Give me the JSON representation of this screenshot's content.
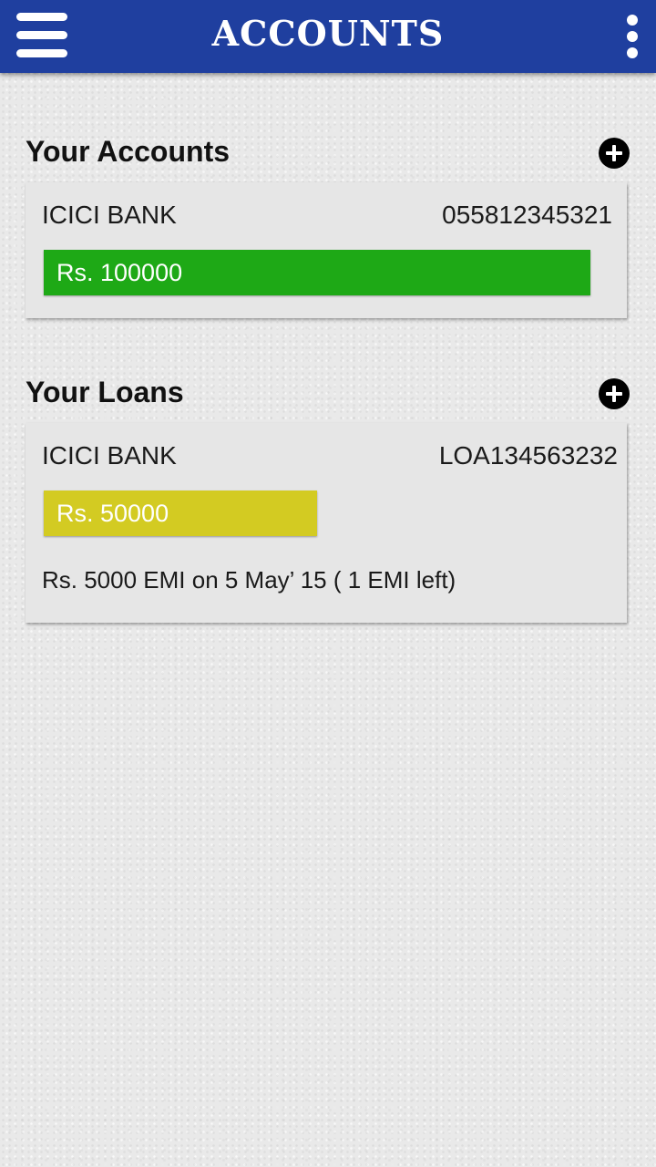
{
  "header": {
    "title": "ACCOUNTS",
    "menu_icon": "hamburger-menu-icon",
    "overflow_icon": "vertical-dots-icon",
    "background_color": "#1f3f9f"
  },
  "accounts_section": {
    "title": "Your Accounts",
    "add_icon": "plus-circle-icon",
    "items": [
      {
        "bank": "ICICI BANK",
        "number": "055812345321",
        "amount": "Rs. 100000",
        "bar_color": "#1ea916",
        "bar_fill_fraction": 1.0
      }
    ]
  },
  "loans_section": {
    "title": "Your Loans",
    "add_icon": "plus-circle-icon",
    "items": [
      {
        "bank": "ICICI BANK",
        "number": "LOA134563232",
        "amount": "Rs. 50000",
        "bar_color": "#d3cb22",
        "bar_fill_fraction": 0.5,
        "emi": "Rs. 5000 EMI on 5 May’ 15 ( 1 EMI left)"
      }
    ]
  }
}
